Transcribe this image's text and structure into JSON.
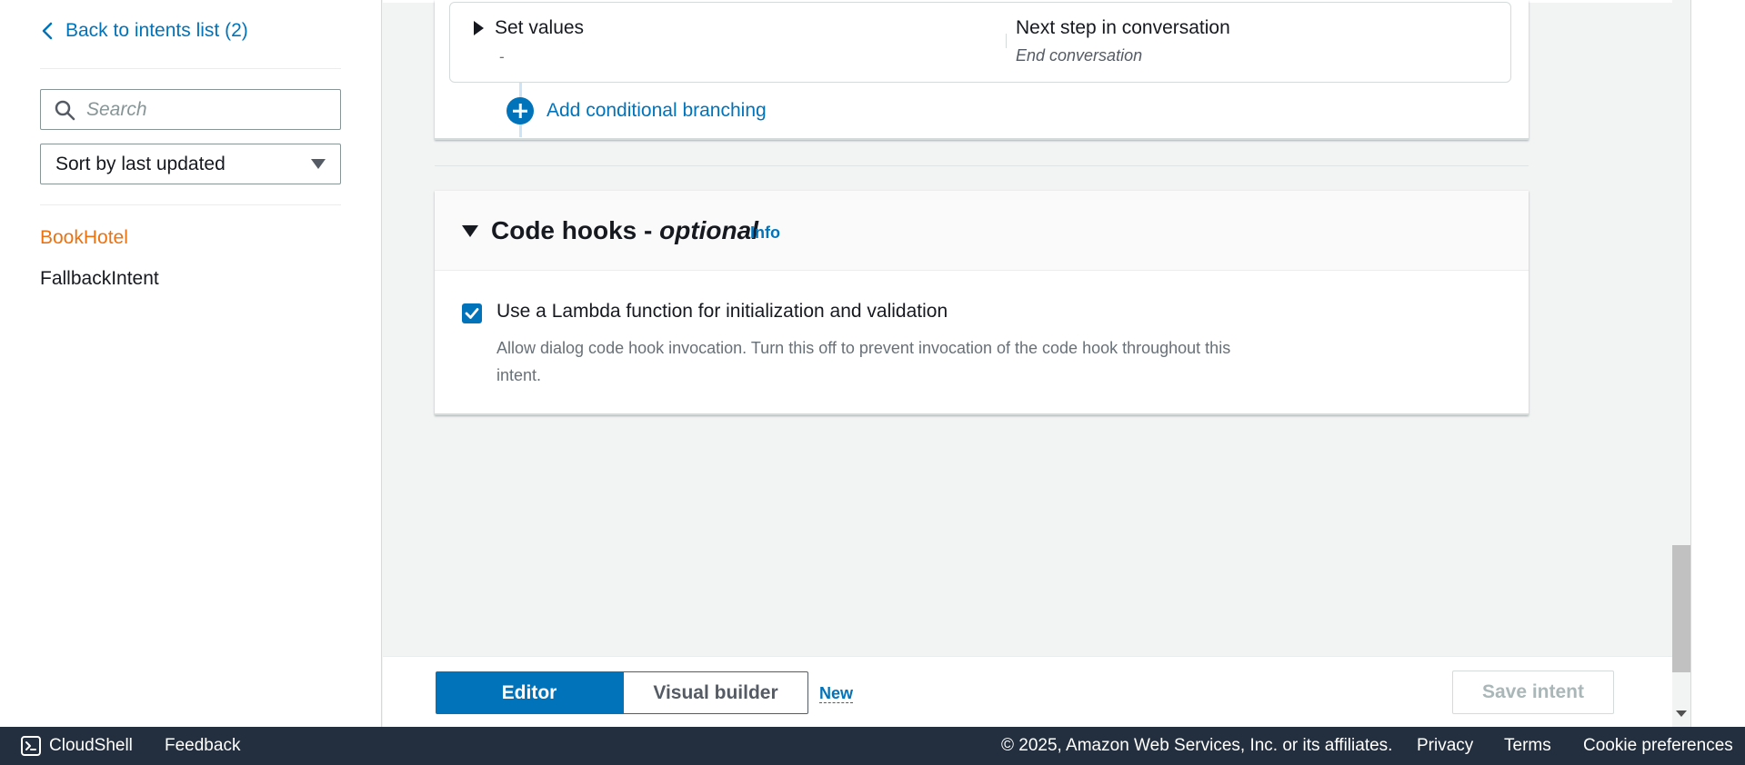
{
  "sidebar": {
    "back_link": "Back to intents list (2)",
    "search_placeholder": "Search",
    "sort_label": "Sort by last updated",
    "intents": [
      {
        "label": "BookHotel",
        "active": true
      },
      {
        "label": "FallbackIntent",
        "active": false
      }
    ]
  },
  "branching": {
    "set_values_label": "Set values",
    "set_values_value": "-",
    "next_step_label": "Next step in conversation",
    "next_step_value": "End conversation",
    "add_branch_label": "Add conditional branching"
  },
  "code_hooks": {
    "title_main": "Code hooks - ",
    "title_optional": "optional",
    "info_label": "Info",
    "checkbox_checked": true,
    "checkbox_label": "Use a Lambda function for initialization and validation",
    "checkbox_description": "Allow dialog code hook invocation. Turn this off to prevent invocation of the code hook throughout this intent."
  },
  "toolbar": {
    "editor_label": "Editor",
    "visual_builder_label": "Visual builder",
    "new_badge": "New",
    "save_label": "Save intent"
  },
  "footer": {
    "cloudshell_label": "CloudShell",
    "feedback_label": "Feedback",
    "copyright": "© 2025, Amazon Web Services, Inc. or its affiliates.",
    "privacy_label": "Privacy",
    "terms_label": "Terms",
    "cookie_label": "Cookie preferences"
  },
  "colors": {
    "accent": "#0073bb",
    "active_intent": "#ec7211",
    "footer_bg": "#232f3e"
  }
}
